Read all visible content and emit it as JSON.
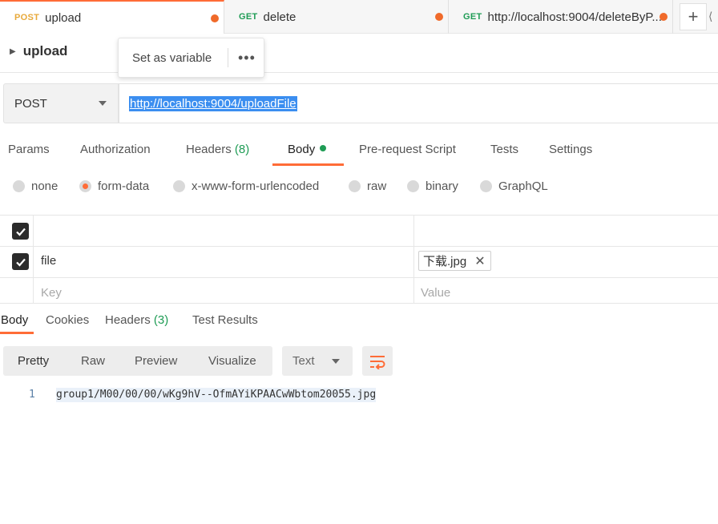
{
  "tabs": [
    {
      "method": "POST",
      "name": "upload",
      "active": true
    },
    {
      "method": "GET",
      "name": "delete",
      "active": false
    },
    {
      "method": "GET",
      "name": "http://localhost:9004/deleteByP...",
      "active": false
    }
  ],
  "new_tab_label": "+",
  "request": {
    "title": "upload",
    "method": "POST",
    "url": "http://localhost:9004/uploadFile"
  },
  "popover": {
    "label": "Set as variable",
    "more": "•••"
  },
  "request_tabs": {
    "params": "Params",
    "authorization": "Authorization",
    "headers": "Headers",
    "headers_count": "(8)",
    "body": "Body",
    "pre_request": "Pre-request Script",
    "tests": "Tests",
    "settings": "Settings"
  },
  "body_types": {
    "none": "none",
    "form_data": "form-data",
    "urlencoded": "x-www-form-urlencoded",
    "raw": "raw",
    "binary": "binary",
    "graphql": "GraphQL",
    "selected": "form-data"
  },
  "form_rows": [
    {
      "checked": true,
      "key": "",
      "value": ""
    },
    {
      "checked": true,
      "key": "file",
      "value": "下载.jpg"
    }
  ],
  "form_placeholders": {
    "key": "Key",
    "value": "Value"
  },
  "response_tabs": {
    "body": "Body",
    "cookies": "Cookies",
    "headers": "Headers",
    "headers_count": "(3)",
    "test_results": "Test Results"
  },
  "view_modes": {
    "pretty": "Pretty",
    "raw": "Raw",
    "preview": "Preview",
    "visualize": "Visualize",
    "format": "Text"
  },
  "response_body": {
    "line_number": "1",
    "line_text": "group1/M00/00/00/wKg9hV--OfmAYiKPAACwWbtom20055.jpg"
  },
  "colors": {
    "accent": "#ff6c37",
    "get_method": "#1f9c55",
    "post_method": "#e8a93a",
    "selection": "#3b8ef0"
  }
}
